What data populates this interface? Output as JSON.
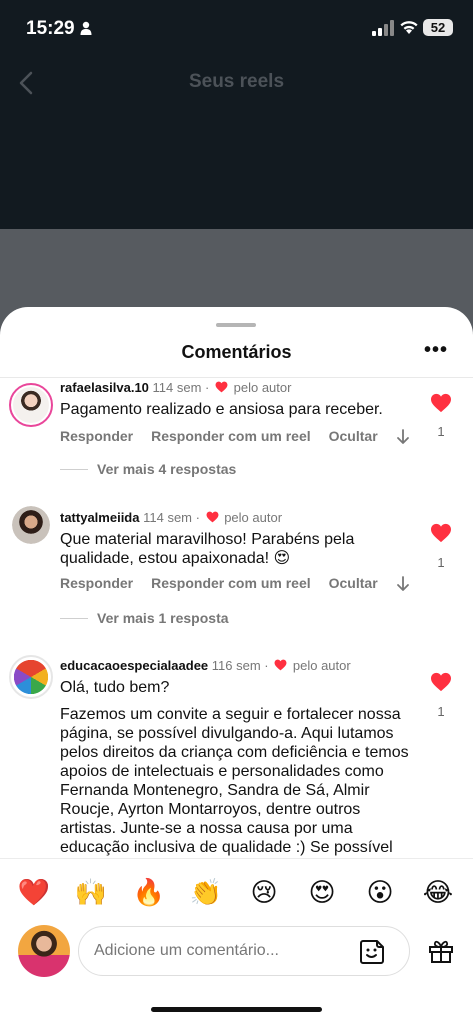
{
  "status_bar": {
    "time": "15:29",
    "battery": "52"
  },
  "nav": {
    "title": "Seus reels"
  },
  "sheet": {
    "title": "Comentários"
  },
  "comments": [
    {
      "username": "rafaelasilva.10",
      "age": "114 sem",
      "by_author": "pelo autor",
      "text": "Pagamento realizado e ansiosa para receber.",
      "reply": "Responder",
      "reply_reel": "Responder com um reel",
      "hide": "Ocultar",
      "likes": "1",
      "view_replies": "Ver mais 4 respostas"
    },
    {
      "username": "tattyalmeiida",
      "age": "114 sem",
      "by_author": "pelo autor",
      "text": "Que material maravilhoso! Parabéns pela qualidade, estou apaixonada! 😍",
      "reply": "Responder",
      "reply_reel": "Responder com um reel",
      "hide": "Ocultar",
      "likes": "1",
      "view_replies": "Ver mais 1 resposta"
    },
    {
      "username": "educacaoespecialaadee",
      "age": "116 sem",
      "by_author": "pelo autor",
      "greeting": "Olá, tudo bem?",
      "text": "Fazemos um convite a seguir e fortalecer nossa página, se possível divulgando-a. Aqui lutamos pelos direitos da criança com deficiência e temos apoios de intelectuais e personalidades como Fernanda Montenegro, Sandra de Sá, Almir Roucje, Ayrton Montarroyos, dentre outros artistas. Junte-se a nossa causa por uma educação inclusiva de qualidade :) Se possível pedindo que veja",
      "likes": "1"
    }
  ],
  "emojis": [
    "❤️",
    "🙌",
    "🔥",
    "👏",
    "😢",
    "😍",
    "😮",
    "😂"
  ],
  "composer": {
    "placeholder": "Adicione um comentário..."
  },
  "colors": {
    "like_red": "#ff3040",
    "sheet_bg": "#ffffff",
    "backdrop": "#121a20"
  }
}
